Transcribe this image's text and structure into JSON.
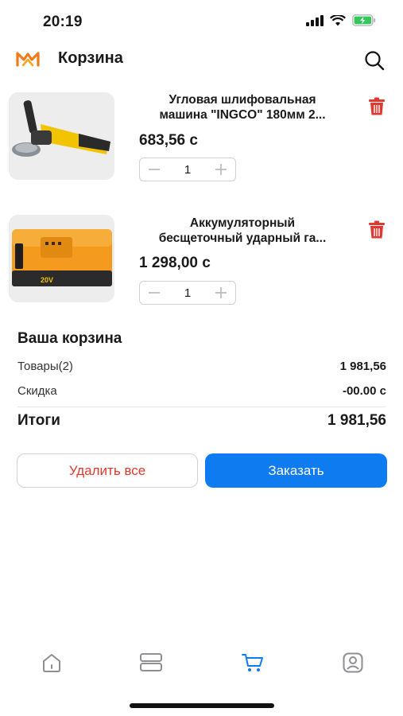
{
  "status_bar": {
    "time": "20:19"
  },
  "header": {
    "title": "Корзина"
  },
  "cart": {
    "items": [
      {
        "name_line1": "Угловая шлифовальная",
        "name_line2": "машина \"INGCO\" 180мм 2...",
        "price": "683,56 с",
        "quantity": "1",
        "image": "angle-grinder-photo"
      },
      {
        "name_line1": "Аккумуляторный",
        "name_line2": "бесщеточный ударный га...",
        "price": "1 298,00 с",
        "quantity": "1",
        "image": "battery-pack-photo"
      }
    ]
  },
  "summary": {
    "title": "Ваша корзина",
    "goods_label": "Товары(2)",
    "goods_value": "1 981,56",
    "discount_label": "Скидка",
    "discount_value": "-00.00 с",
    "total_label": "Итоги",
    "total_value": "1 981,56"
  },
  "actions": {
    "delete_all": "Удалить все",
    "order": "Заказать"
  },
  "tabbar": {
    "items": [
      "home-icon",
      "catalog-icon",
      "cart-icon",
      "profile-icon"
    ],
    "active": "cart-icon"
  },
  "colors": {
    "accent": "#0f7bf0",
    "danger": "#e0392f",
    "logo": "#f07a1a",
    "battery": "#34c759"
  }
}
